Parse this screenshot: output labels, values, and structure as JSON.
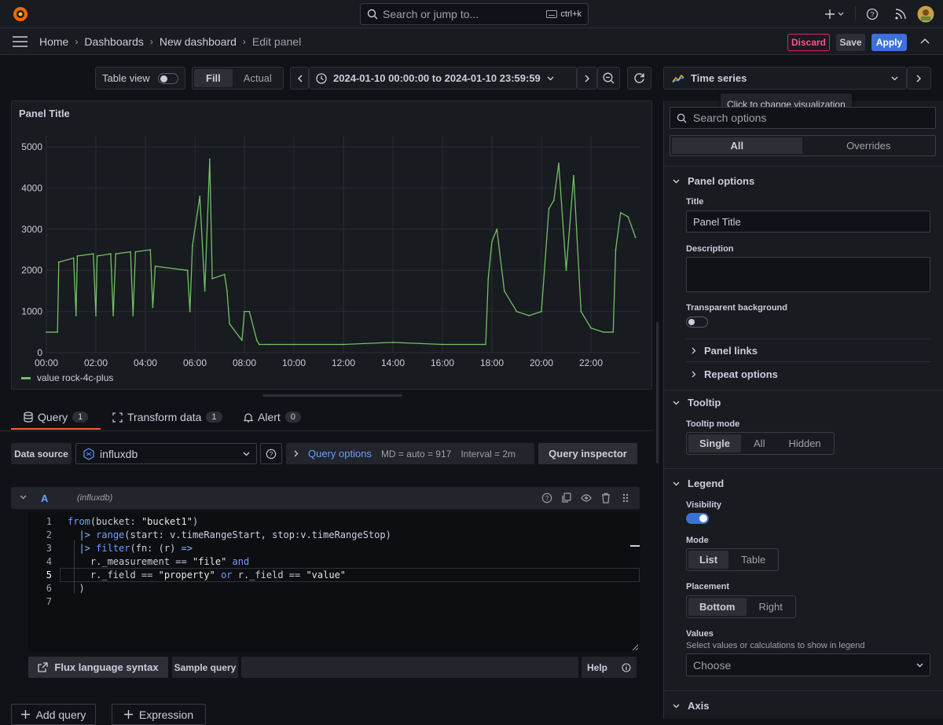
{
  "topbar": {
    "search_placeholder": "Search or jump to...",
    "shortcut": "ctrl+k"
  },
  "breadcrumbs": [
    "Home",
    "Dashboards",
    "New dashboard",
    "Edit panel"
  ],
  "actions": {
    "discard": "Discard",
    "save": "Save",
    "apply": "Apply"
  },
  "toolbar": {
    "table_view": "Table view",
    "fill": "Fill",
    "actual": "Actual",
    "time_range": "2024-01-10 00:00:00 to 2024-01-10 23:59:59"
  },
  "visualization": {
    "name": "Time series",
    "tooltip": "Click to change visualization"
  },
  "panel": {
    "title": "Panel Title",
    "legend": "value rock-4c-plus",
    "line_color": "#73bf69",
    "y_ticks": [
      "5000",
      "4000",
      "3000",
      "2000",
      "1000",
      "0"
    ],
    "x_ticks": [
      "00:00",
      "02:00",
      "04:00",
      "06:00",
      "08:00",
      "10:00",
      "12:00",
      "14:00",
      "16:00",
      "18:00",
      "20:00",
      "22:00"
    ]
  },
  "chart_data": {
    "type": "line",
    "title": "Panel Title",
    "xlabel": "",
    "ylabel": "",
    "ylim": [
      0,
      5000
    ],
    "xlim": [
      "00:00",
      "24:00"
    ],
    "grid": true,
    "legend_position": "bottom",
    "series": [
      {
        "name": "value rock-4c-plus",
        "x": [
          0,
          0.45,
          0.5,
          1.1,
          1.2,
          1.25,
          1.9,
          2.0,
          2.05,
          2.6,
          2.7,
          2.8,
          3.4,
          3.5,
          3.6,
          4.2,
          4.3,
          4.4,
          5.7,
          5.8,
          5.9,
          6.2,
          6.4,
          6.6,
          6.7,
          7.2,
          7.3,
          7.4,
          7.9,
          8.0,
          8.2,
          8.5,
          8.6,
          9.0,
          10.0,
          12.0,
          14.0,
          16.0,
          17.6,
          17.75,
          17.85,
          18.0,
          18.2,
          18.5,
          19.0,
          19.5,
          20.0,
          20.3,
          20.5,
          20.7,
          21.0,
          21.3,
          21.6,
          22.0,
          22.5,
          22.9,
          23.0,
          23.2,
          23.5,
          23.8
        ],
        "values": [
          500,
          500,
          2200,
          2300,
          900,
          2350,
          2400,
          900,
          2350,
          2400,
          900,
          2400,
          2450,
          900,
          2450,
          2500,
          1100,
          2100,
          2000,
          1000,
          2600,
          3800,
          1500,
          4700,
          1800,
          1900,
          1500,
          700,
          300,
          1000,
          1000,
          300,
          200,
          200,
          200,
          200,
          250,
          200,
          200,
          200,
          1800,
          2700,
          3000,
          1500,
          1000,
          900,
          1000,
          3500,
          3700,
          4600,
          2000,
          4300,
          1000,
          600,
          500,
          500,
          2500,
          3400,
          3300,
          2800
        ]
      }
    ]
  },
  "tabs": [
    {
      "label": "Query",
      "count": "1"
    },
    {
      "label": "Transform data",
      "count": "1"
    },
    {
      "label": "Alert",
      "count": "0"
    }
  ],
  "query": {
    "data_source_label": "Data source",
    "data_source": "influxdb",
    "query_options": "Query options",
    "md": "MD = auto = 917",
    "interval": "Interval = 2m",
    "inspector": "Query inspector",
    "ref_id": "A",
    "ref_source": "(influxdb)",
    "flux_syntax": "Flux language syntax",
    "sample_query": "Sample query",
    "help": "Help",
    "add_query": "Add query",
    "expression": "Expression"
  },
  "code_lines": [
    {
      "n": "1",
      "t": "from(bucket: \"bucket1\")"
    },
    {
      "n": "2",
      "t": "  |> range(start: v.timeRangeStart, stop:v.timeRangeStop)"
    },
    {
      "n": "3",
      "t": "  |> filter(fn: (r) =>"
    },
    {
      "n": "4",
      "t": "    r._measurement == \"file\" and"
    },
    {
      "n": "5",
      "t": "    r._field == \"property\" or r._field == \"value\""
    },
    {
      "n": "6",
      "t": "  )"
    },
    {
      "n": "7",
      "t": ""
    }
  ],
  "options": {
    "search_placeholder": "Search options",
    "tab_all": "All",
    "tab_overrides": "Overrides",
    "panel_options": "Panel options",
    "title_label": "Title",
    "title_value": "Panel Title",
    "description_label": "Description",
    "transparent_label": "Transparent background",
    "panel_links": "Panel links",
    "repeat_options": "Repeat options",
    "tooltip": "Tooltip",
    "tooltip_mode_label": "Tooltip mode",
    "tooltip_modes": [
      "Single",
      "All",
      "Hidden"
    ],
    "legend": "Legend",
    "visibility_label": "Visibility",
    "mode_label": "Mode",
    "modes": [
      "List",
      "Table"
    ],
    "placement_label": "Placement",
    "placements": [
      "Bottom",
      "Right"
    ],
    "values_label": "Values",
    "values_desc": "Select values or calculations to show in legend",
    "values_choose": "Choose",
    "axis": "Axis"
  }
}
